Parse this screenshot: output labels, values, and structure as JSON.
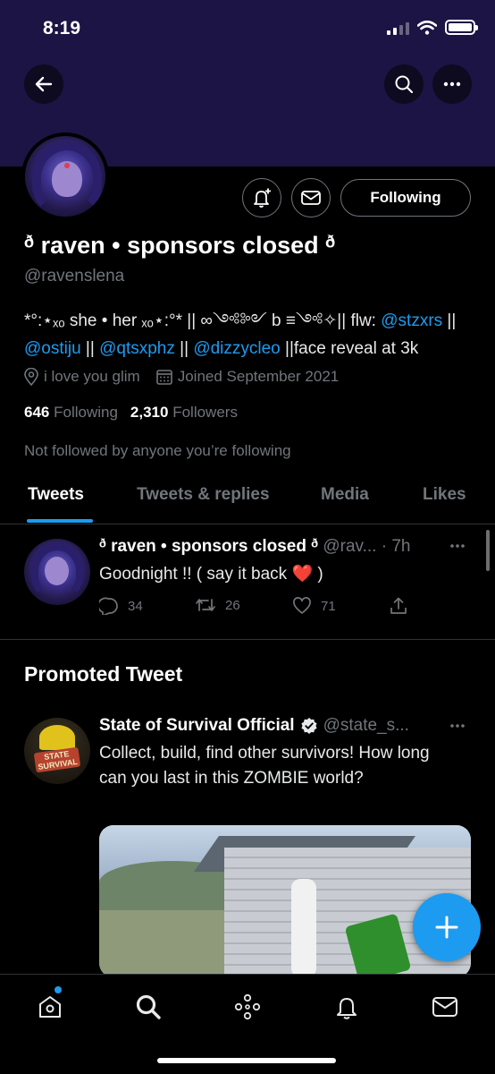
{
  "status_bar": {
    "time": "8:19"
  },
  "profile": {
    "display_name": "ᶞ raven • sponsors closed ᶞ",
    "handle": "@ravenslena",
    "following_button": "Following",
    "bio": {
      "prefix": "*°:⋆ₓₒ she • her ₓₒ⋆:°* || ∞༺༻ b ≡༺✧|| flw: ",
      "mention_1": "@stzxrs",
      "sep_1": " || ",
      "mention_2": "@ostiju",
      "sep_2": " || ",
      "mention_3": "@qtsxphz",
      "sep_3": " || ",
      "mention_4": "@dizzycleo",
      "suffix": " ||face reveal at 3k"
    },
    "location": "i love you glim",
    "joined": "Joined September 2021",
    "following_count": "646",
    "following_label": "Following",
    "followers_count": "2,310",
    "followers_label": "Followers",
    "not_followed": "Not followed by anyone you’re following"
  },
  "tabs": [
    {
      "label": "Tweets",
      "active": true
    },
    {
      "label": "Tweets & replies",
      "active": false
    },
    {
      "label": "Media",
      "active": false
    },
    {
      "label": "Likes",
      "active": false
    }
  ],
  "tweet": {
    "name": "ᶞ raven • sponsors closed ᶞ",
    "handle_time": " @rav... · 7h",
    "text_before": "Goodnight !! ( say it back ",
    "heart": "❤️",
    "text_after": " )",
    "replies": "34",
    "retweets": "26",
    "likes": "71"
  },
  "promoted": {
    "section_title": "Promoted Tweet",
    "name": "State of Survival Official",
    "handle": "@state_s...",
    "text": "Collect, build, find other survivors! How long can you last in this ZOMBIE world?",
    "logo_text": "STATE SURVIVAL"
  },
  "nav": {
    "items": [
      "home-icon",
      "search-icon",
      "spaces-icon",
      "notifications-icon",
      "messages-icon"
    ]
  },
  "colors": {
    "accent": "#1d9bf0",
    "banner": "#1c1444",
    "secondary_text": "#71767b",
    "heart": "#e0245e"
  }
}
